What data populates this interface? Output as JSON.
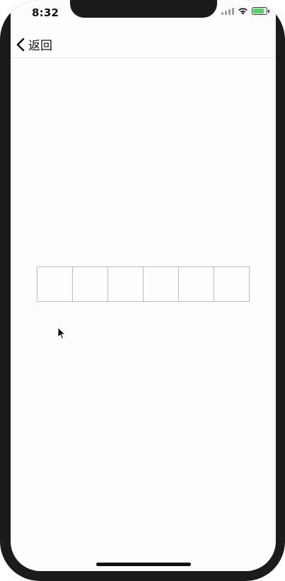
{
  "status_bar": {
    "time": "8:32",
    "icons": [
      "signal-icon",
      "wifi-icon",
      "battery-charging-icon"
    ],
    "battery_level": 0.8,
    "battery_color": "#4cd964"
  },
  "nav": {
    "back_label": "返回",
    "back_icon": "chevron-left-icon"
  },
  "code_input": {
    "digits": [
      "",
      "",
      "",
      "",
      "",
      ""
    ],
    "border_color": "#bdbdbd"
  }
}
